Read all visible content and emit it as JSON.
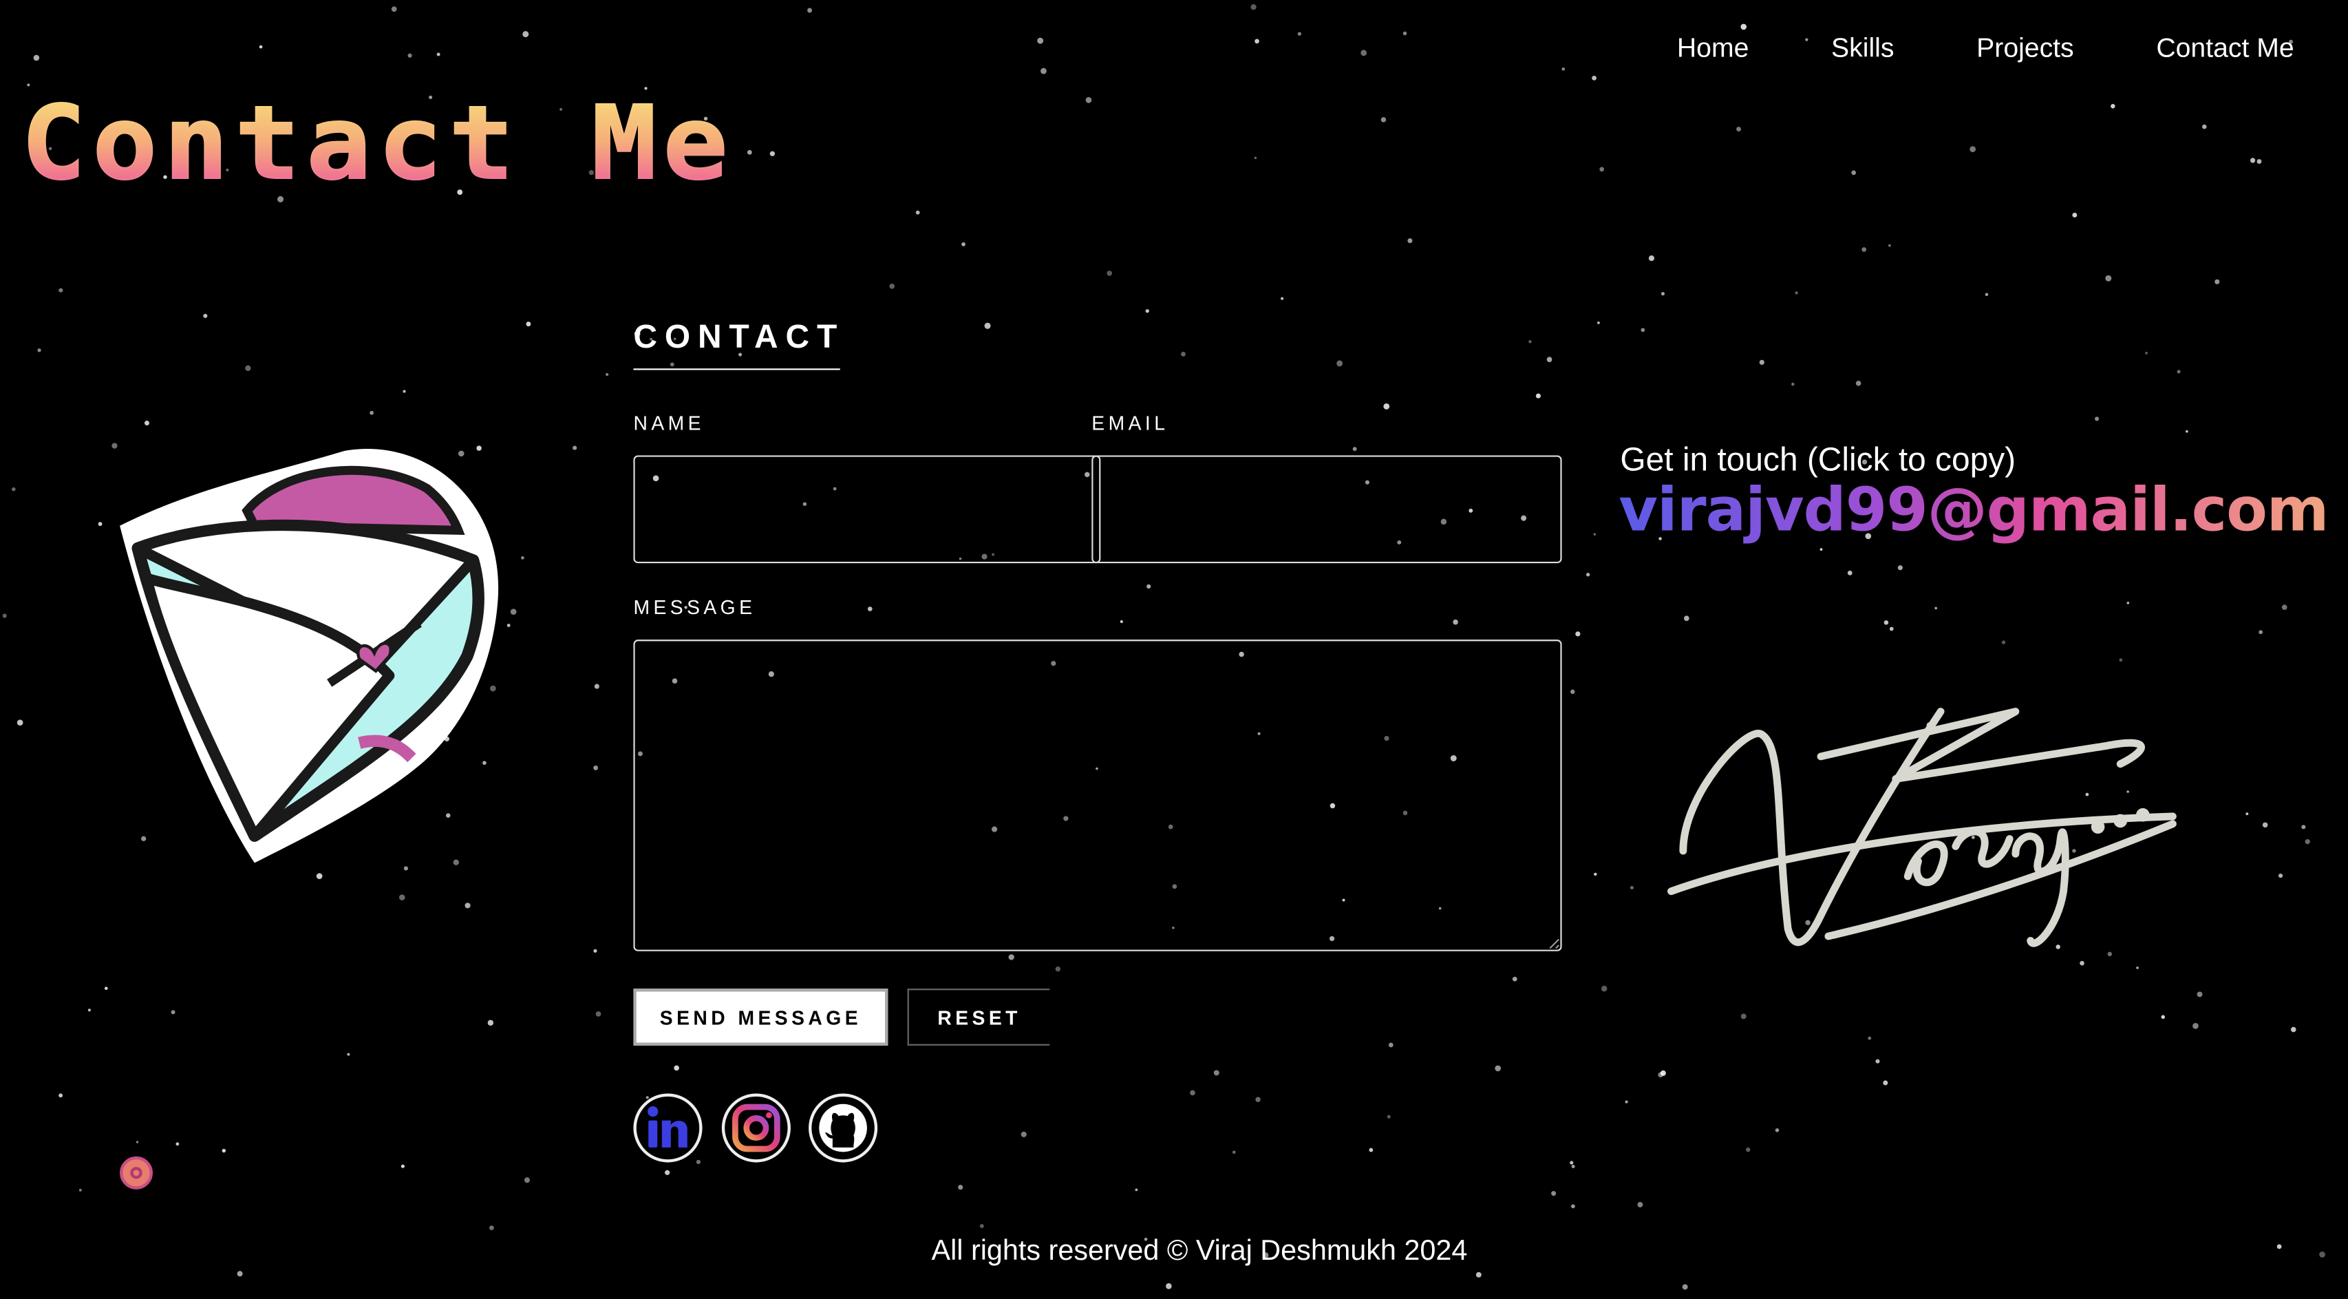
{
  "nav": {
    "items": [
      "Home",
      "Skills",
      "Projects",
      "Contact Me"
    ]
  },
  "header": {
    "title": "Contact Me"
  },
  "form": {
    "title": "CONTACT",
    "name_label": "NAME",
    "email_label": "EMAIL",
    "message_label": "MESSAGE",
    "name_value": "",
    "email_value": "",
    "message_value": "",
    "send_label": "SEND MESSAGE",
    "reset_label": "RESET"
  },
  "social": {
    "icons": [
      "linkedin-icon",
      "instagram-icon",
      "github-icon"
    ]
  },
  "contact_info": {
    "prompt": "Get in touch (Click to copy)",
    "email": "virajvd99@gmail.com",
    "signature_text": "Viraj..."
  },
  "footer": {
    "text": "All rights reserved © Viraj Deshmukh 2024"
  },
  "colors": {
    "background": "#000000",
    "title_gradient": [
      "#f7df7a",
      "#ec4fa0"
    ],
    "email_gradient": [
      "#5b5ce6",
      "#9b4fd6",
      "#e04f9d",
      "#f0a582"
    ],
    "linkedin": "#3b3ee0",
    "instagram": "#e0407a"
  }
}
